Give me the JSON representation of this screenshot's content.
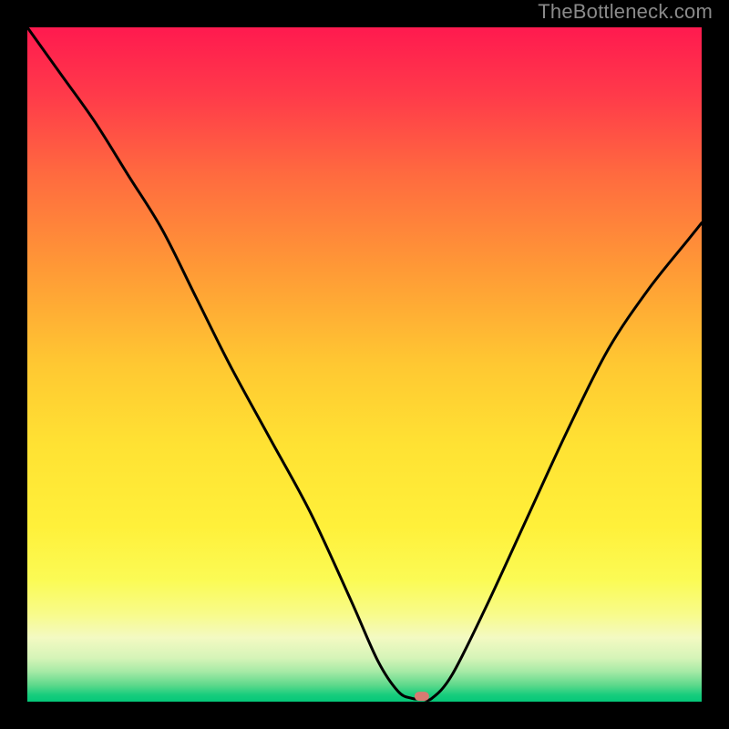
{
  "watermark": "TheBottleneck.com",
  "chart_data": {
    "type": "line",
    "title": "",
    "xlabel": "",
    "ylabel": "",
    "xlim": [
      0,
      100
    ],
    "ylim": [
      0,
      100
    ],
    "grid": false,
    "legend": false,
    "series": [
      {
        "name": "bottleneck-curve",
        "color": "#000000",
        "x": [
          0,
          5,
          10,
          15,
          20,
          25,
          30,
          36,
          42,
          48,
          52,
          55,
          57,
          58.5,
          60,
          63,
          68,
          74,
          80,
          86,
          92,
          98,
          100
        ],
        "y": [
          100,
          93,
          86,
          78,
          70,
          60,
          50,
          39,
          28,
          15,
          6,
          1.5,
          0.5,
          0.4,
          0.5,
          4,
          14,
          27,
          40,
          52,
          61,
          68.5,
          71
        ]
      }
    ],
    "marker": {
      "x": 58.5,
      "y": 0.8,
      "color": "#d77a72"
    },
    "background_gradient": {
      "stops": [
        {
          "offset": 0.0,
          "color": "#ff1a4f"
        },
        {
          "offset": 0.1,
          "color": "#ff3a4a"
        },
        {
          "offset": 0.22,
          "color": "#ff6b3f"
        },
        {
          "offset": 0.36,
          "color": "#ff9a36"
        },
        {
          "offset": 0.5,
          "color": "#ffc832"
        },
        {
          "offset": 0.62,
          "color": "#ffe233"
        },
        {
          "offset": 0.74,
          "color": "#fff03a"
        },
        {
          "offset": 0.82,
          "color": "#fbfb55"
        },
        {
          "offset": 0.87,
          "color": "#f8fb8a"
        },
        {
          "offset": 0.905,
          "color": "#f3fac2"
        },
        {
          "offset": 0.935,
          "color": "#d6f4b8"
        },
        {
          "offset": 0.955,
          "color": "#a7eaa6"
        },
        {
          "offset": 0.975,
          "color": "#5fd98c"
        },
        {
          "offset": 0.99,
          "color": "#17cd7d"
        },
        {
          "offset": 1.0,
          "color": "#05c779"
        }
      ]
    }
  }
}
